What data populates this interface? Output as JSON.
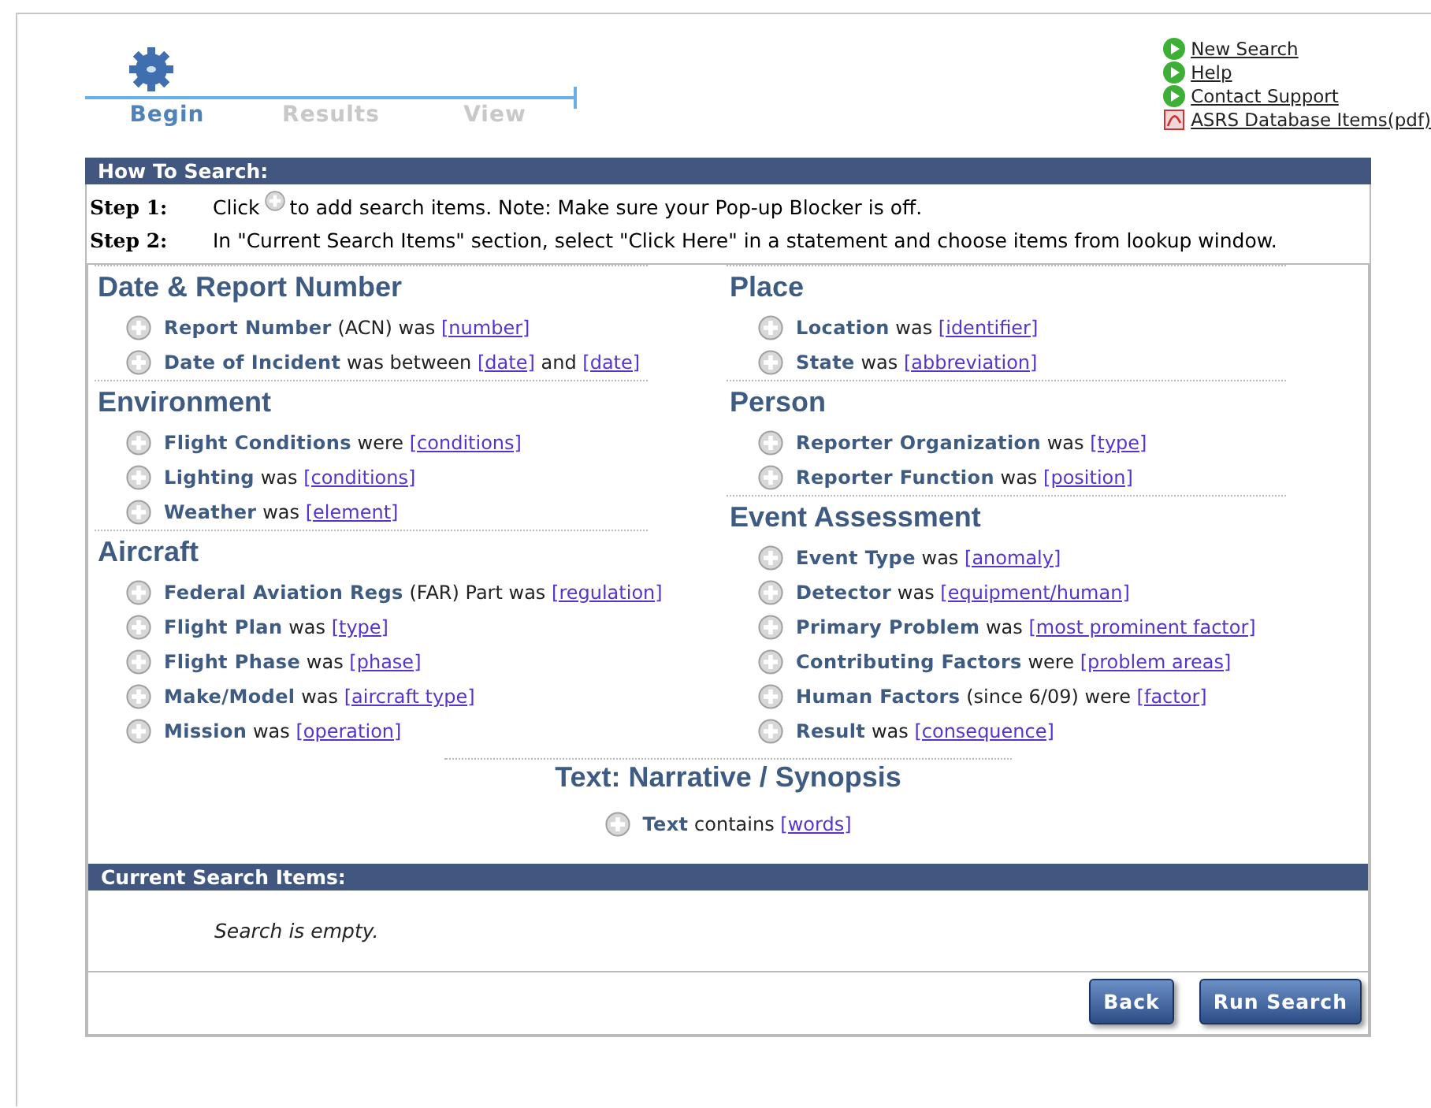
{
  "wizard": {
    "steps": [
      {
        "label": "Begin",
        "selected": true
      },
      {
        "label": "Results",
        "selected": false
      },
      {
        "label": "View",
        "selected": false
      }
    ]
  },
  "links": [
    {
      "kind": "go",
      "text": "New Search"
    },
    {
      "kind": "go",
      "text": "Help"
    },
    {
      "kind": "go",
      "text": "Contact Support"
    },
    {
      "kind": "pdf",
      "text": "ASRS Database Items(pdf)"
    }
  ],
  "how_to": {
    "title": "How To Search:",
    "steps": [
      {
        "label": "Step 1:",
        "before": "Click",
        "after": "to add search items. Note: Make sure your Pop-up Blocker is off."
      },
      {
        "label": "Step 2:",
        "text": "In \"Current Search Items\" section, select \"Click Here\" in a statement and choose items from lookup window."
      }
    ]
  },
  "columns": [
    [
      {
        "title": "Date & Report Number",
        "items": [
          [
            {
              "kind": "field",
              "text": "Report Number"
            },
            {
              "kind": "plain",
              "text": "(ACN) was"
            },
            {
              "kind": "link",
              "text": "[number]"
            }
          ],
          [
            {
              "kind": "field",
              "text": "Date of Incident"
            },
            {
              "kind": "plain",
              "text": "was between"
            },
            {
              "kind": "link",
              "text": "[date]"
            },
            {
              "kind": "plain",
              "text": "and"
            },
            {
              "kind": "link",
              "text": "[date]"
            }
          ]
        ]
      },
      {
        "title": "Environment",
        "items": [
          [
            {
              "kind": "field",
              "text": "Flight Conditions"
            },
            {
              "kind": "plain",
              "text": "were"
            },
            {
              "kind": "link",
              "text": "[conditions]"
            }
          ],
          [
            {
              "kind": "field",
              "text": "Lighting"
            },
            {
              "kind": "plain",
              "text": "was"
            },
            {
              "kind": "link",
              "text": "[conditions]"
            }
          ],
          [
            {
              "kind": "field",
              "text": "Weather"
            },
            {
              "kind": "plain",
              "text": "was"
            },
            {
              "kind": "link",
              "text": "[element]"
            }
          ]
        ]
      },
      {
        "title": "Aircraft",
        "items": [
          [
            {
              "kind": "field",
              "text": "Federal Aviation Regs"
            },
            {
              "kind": "plain",
              "text": "(FAR) Part was"
            },
            {
              "kind": "link",
              "text": "[regulation]"
            }
          ],
          [
            {
              "kind": "field",
              "text": "Flight Plan"
            },
            {
              "kind": "plain",
              "text": "was"
            },
            {
              "kind": "link",
              "text": "[type]"
            }
          ],
          [
            {
              "kind": "field",
              "text": "Flight Phase"
            },
            {
              "kind": "plain",
              "text": "was"
            },
            {
              "kind": "link",
              "text": "[phase]"
            }
          ],
          [
            {
              "kind": "field",
              "text": "Make/Model"
            },
            {
              "kind": "plain",
              "text": "was"
            },
            {
              "kind": "link",
              "text": "[aircraft type]"
            }
          ],
          [
            {
              "kind": "field",
              "text": "Mission"
            },
            {
              "kind": "plain",
              "text": "was"
            },
            {
              "kind": "link",
              "text": "[operation]"
            }
          ]
        ]
      }
    ],
    [
      {
        "title": "Place",
        "items": [
          [
            {
              "kind": "field",
              "text": "Location"
            },
            {
              "kind": "plain",
              "text": "was"
            },
            {
              "kind": "link",
              "text": "[identifier]"
            }
          ],
          [
            {
              "kind": "field",
              "text": "State"
            },
            {
              "kind": "plain",
              "text": "was"
            },
            {
              "kind": "link",
              "text": "[abbreviation]"
            }
          ]
        ]
      },
      {
        "title": "Person",
        "items": [
          [
            {
              "kind": "field",
              "text": "Reporter Organization"
            },
            {
              "kind": "plain",
              "text": "was"
            },
            {
              "kind": "link",
              "text": "[type]"
            }
          ],
          [
            {
              "kind": "field",
              "text": "Reporter Function"
            },
            {
              "kind": "plain",
              "text": "was"
            },
            {
              "kind": "link",
              "text": "[position]"
            }
          ]
        ]
      },
      {
        "title": "Event Assessment",
        "items": [
          [
            {
              "kind": "field",
              "text": "Event Type"
            },
            {
              "kind": "plain",
              "text": "was"
            },
            {
              "kind": "link",
              "text": "[anomaly]"
            }
          ],
          [
            {
              "kind": "field",
              "text": "Detector"
            },
            {
              "kind": "plain",
              "text": "was"
            },
            {
              "kind": "link",
              "text": "[equipment/human]"
            }
          ],
          [
            {
              "kind": "field",
              "text": "Primary Problem"
            },
            {
              "kind": "plain",
              "text": "was"
            },
            {
              "kind": "link",
              "text": "[most prominent factor]"
            }
          ],
          [
            {
              "kind": "field",
              "text": "Contributing Factors"
            },
            {
              "kind": "plain",
              "text": "were"
            },
            {
              "kind": "link",
              "text": "[problem areas]"
            }
          ],
          [
            {
              "kind": "field",
              "text": "Human Factors"
            },
            {
              "kind": "plain",
              "text": "(since 6/09) were"
            },
            {
              "kind": "link",
              "text": "[factor]"
            }
          ],
          [
            {
              "kind": "field",
              "text": "Result"
            },
            {
              "kind": "plain",
              "text": "was"
            },
            {
              "kind": "link",
              "text": "[consequence]"
            }
          ]
        ]
      }
    ]
  ],
  "text_section": {
    "title": "Text: Narrative / Synopsis",
    "items": [
      [
        {
          "kind": "field",
          "text": "Text"
        },
        {
          "kind": "plain",
          "text": "contains"
        },
        {
          "kind": "link",
          "text": "[words]"
        }
      ]
    ]
  },
  "current": {
    "title": "Current Search Items:",
    "empty": "Search is empty."
  },
  "buttons": [
    "Back",
    "Run Search"
  ]
}
